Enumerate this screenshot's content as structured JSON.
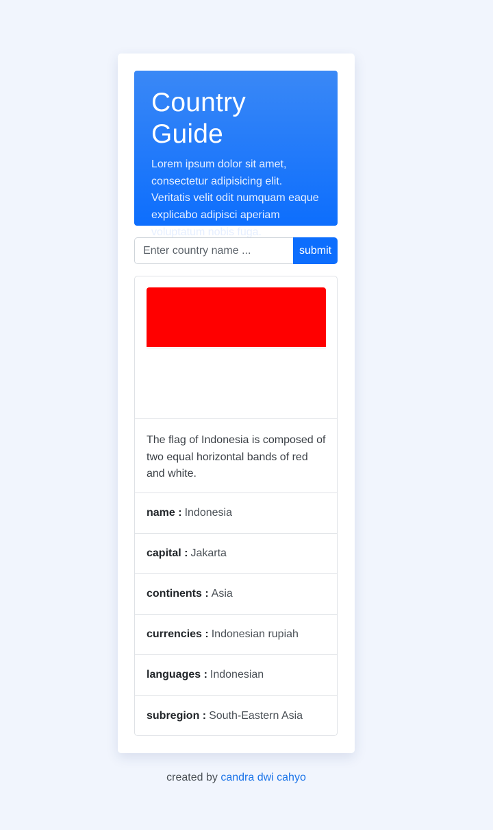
{
  "header": {
    "title": "Country Guide",
    "description": "Lorem ipsum dolor sit amet, consectetur adipisicing elit. Veritatis velit odit numquam eaque explicabo adipisci aperiam voluptatum nobis fuga."
  },
  "search": {
    "placeholder": "Enter country name ...",
    "value": "",
    "submit_label": "submit"
  },
  "country": {
    "flag_colors": [
      "#ff0000",
      "#ffffff"
    ],
    "flag_description": "The flag of Indonesia is composed of two equal horizontal bands of red and white.",
    "fields": [
      {
        "key": "name :",
        "value": "Indonesia"
      },
      {
        "key": "capital :",
        "value": "Jakarta"
      },
      {
        "key": "continents :",
        "value": "Asia"
      },
      {
        "key": "currencies :",
        "value": "Indonesian rupiah"
      },
      {
        "key": "languages :",
        "value": "Indonesian"
      },
      {
        "key": "subregion :",
        "value": "South-Eastern Asia"
      }
    ]
  },
  "footer": {
    "prefix": "created by",
    "author": "candra dwi cahyo"
  },
  "colors": {
    "accent": "#0d6efd",
    "background": "#f1f5fd"
  }
}
